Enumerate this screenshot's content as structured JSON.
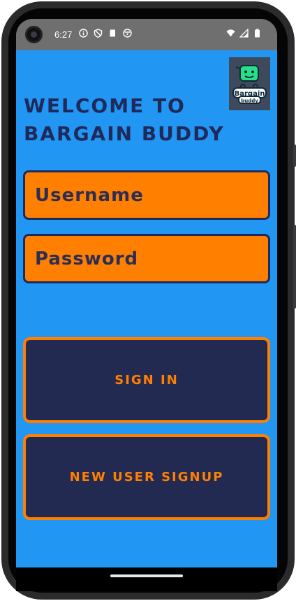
{
  "status_bar": {
    "time": "6:27",
    "icons_left": [
      "info-icon",
      "shield-icon",
      "sd-card-icon",
      "face-icon"
    ],
    "icons_right": [
      "wifi-icon",
      "signal-icon",
      "battery-icon"
    ]
  },
  "app": {
    "logo": {
      "line1": "Bargain",
      "line2": "buddy"
    },
    "title_line1": "WELCOME TO",
    "title_line2": "BARGAIN BUDDY",
    "username": {
      "placeholder": "Username"
    },
    "password": {
      "placeholder": "Password"
    },
    "sign_in_label": "SIGN IN",
    "signup_label": "NEW USER SIGNUP"
  },
  "colors": {
    "background": "#2196f3",
    "navy": "#1f2a5a",
    "orange": "#ff7f00"
  }
}
